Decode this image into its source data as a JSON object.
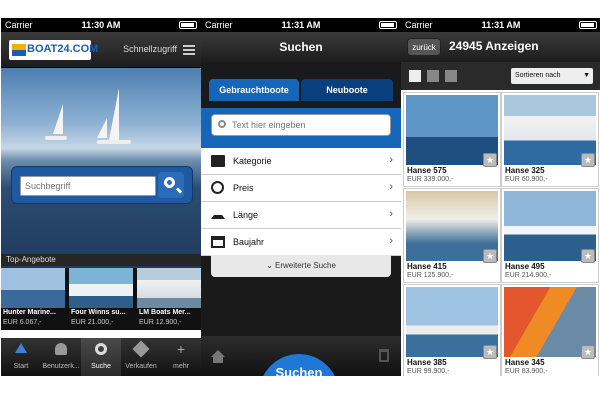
{
  "status": {
    "carrier": "Carrier",
    "time": "11:30 AM",
    "time2": "11:31 AM",
    "time3": "11:31 AM"
  },
  "screen1": {
    "logo": "BOAT24.COM",
    "quick_access": "Schnellzugriff",
    "search_placeholder": "Suchbegriff",
    "top_offers_label": "Top-Angebote",
    "offers": [
      {
        "title": "Hunter Marine...",
        "price": "EUR 6.067,-"
      },
      {
        "title": "Four Winns su...",
        "price": "EUR 21.000,-"
      },
      {
        "title": "LM Boats Mer...",
        "price": "EUR 12.900,-"
      }
    ],
    "tabs": [
      "Start",
      "Benutzerk...",
      "Suche",
      "Verkaufen",
      "mehr"
    ]
  },
  "screen2": {
    "title": "Suchen",
    "segment_used": "Gebrauchtboote",
    "segment_new": "Neuboote",
    "search_placeholder": "Text hier eingeben",
    "rows": [
      "Kategorie",
      "Preis",
      "Länge",
      "Baujahr"
    ],
    "extended_search": "Erweiterte Suche",
    "search_button": "Suchen"
  },
  "screen3": {
    "back_label": "zurück",
    "title": "24945 Anzeigen",
    "sort_label": "Sortieren nach",
    "listings": [
      {
        "name": "Hanse 575",
        "price": "EUR 339.000,-"
      },
      {
        "name": "Hanse 325",
        "price": "EUR 60.900,-"
      },
      {
        "name": "Hanse 415",
        "price": "EUR 125.900,-"
      },
      {
        "name": "Hanse 495",
        "price": "EUR 214.900,-"
      },
      {
        "name": "Hanse 385",
        "price": "EUR 99.900,-"
      },
      {
        "name": "Hanse 345",
        "price": "EUR 83.900,-"
      }
    ]
  },
  "colors": {
    "brand_blue": "#1565b8",
    "dark_nav": "#1d1d1d",
    "accent_yellow": "#f2b100"
  }
}
